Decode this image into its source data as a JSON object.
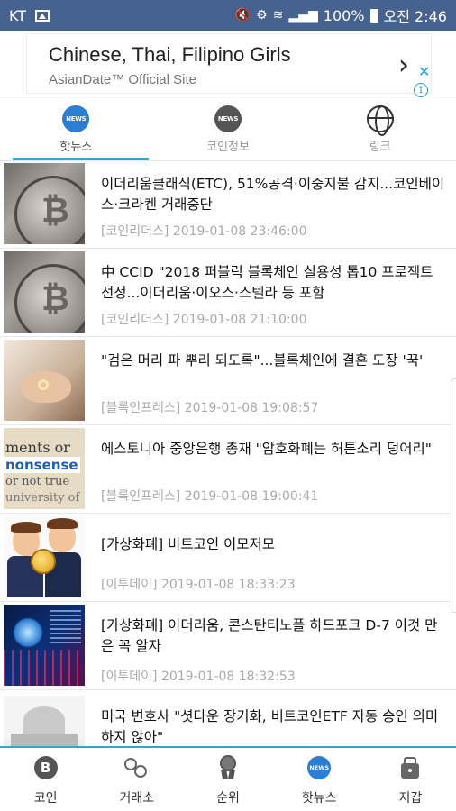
{
  "status_bar": {
    "carrier": "KT",
    "battery": "100%",
    "time": "오전 2:46"
  },
  "ad": {
    "title": "Chinese, Thai, Filipino Girls",
    "subtitle": "AsianDate™ Official Site",
    "close_glyph": "✕",
    "info_glyph": "i",
    "arrow_glyph": "›"
  },
  "tabs": [
    {
      "label": "핫뉴스",
      "icon": "news-badge-icon",
      "badge_text": "NEWS",
      "active": true
    },
    {
      "label": "코인정보",
      "icon": "news-badge-icon",
      "badge_text": "NEWS",
      "active": false
    },
    {
      "label": "링크",
      "icon": "globe-cursor-icon",
      "active": false
    }
  ],
  "news": [
    {
      "title": "이더리움클래식(ETC), 51%공격·이중지불 감지...코인베이스·크라켄 거래중단",
      "source": "[코인리더스]",
      "datetime": "2019-01-08 23:46:00"
    },
    {
      "title": "中 CCID \"2018 퍼블릭 블록체인 실용성 톱10 프로젝트 선정...이더리움·이오스·스텔라 등 포함",
      "source": "[코인리더스]",
      "datetime": "2019-01-08 21:10:00"
    },
    {
      "title": "\"검은 머리 파 뿌리 되도록\"...블록체인에 결혼 도장 '꾹'",
      "source": "[블록인프레스]",
      "datetime": "2019-01-08 19:08:57"
    },
    {
      "title": "에스토니아 중앙은행 총재 \"암호화폐는 허튼소리 덩어리\"",
      "source": "[블록인프레스]",
      "datetime": "2019-01-08 19:00:41",
      "thumb_words": [
        "nonsense",
        "ments or beli",
        "or not true",
        "university of"
      ]
    },
    {
      "title": "[가상화폐] 비트코인 이모저모",
      "source": "[이투데이]",
      "datetime": "2019-01-08 18:33:23"
    },
    {
      "title": "[가상화폐] 이더리움, 콘스탄티노플 하드포크 D-7 이것 만은 꼭 알자",
      "source": "[이투데이]",
      "datetime": "2019-01-08 18:32:53"
    },
    {
      "title": "미국 변호사 \"셧다운 장기화, 비트코인ETF 자동 승인 의미하지 않아\"",
      "source": "",
      "datetime": ""
    }
  ],
  "bottom_nav": [
    {
      "label": "코인",
      "icon": "bitcoin-icon"
    },
    {
      "label": "거래소",
      "icon": "exchange-coins-icon"
    },
    {
      "label": "순위",
      "icon": "medal-icon"
    },
    {
      "label": "핫뉴스",
      "icon": "news-badge-icon",
      "badge_text": "NEWS"
    },
    {
      "label": "지갑",
      "icon": "wallet-icon"
    }
  ],
  "colors": {
    "status_bar_bg": "#46628e",
    "accent": "#2caad0",
    "news_badge_active": "#2a7fd4",
    "meta_text": "#aaaaaa"
  }
}
